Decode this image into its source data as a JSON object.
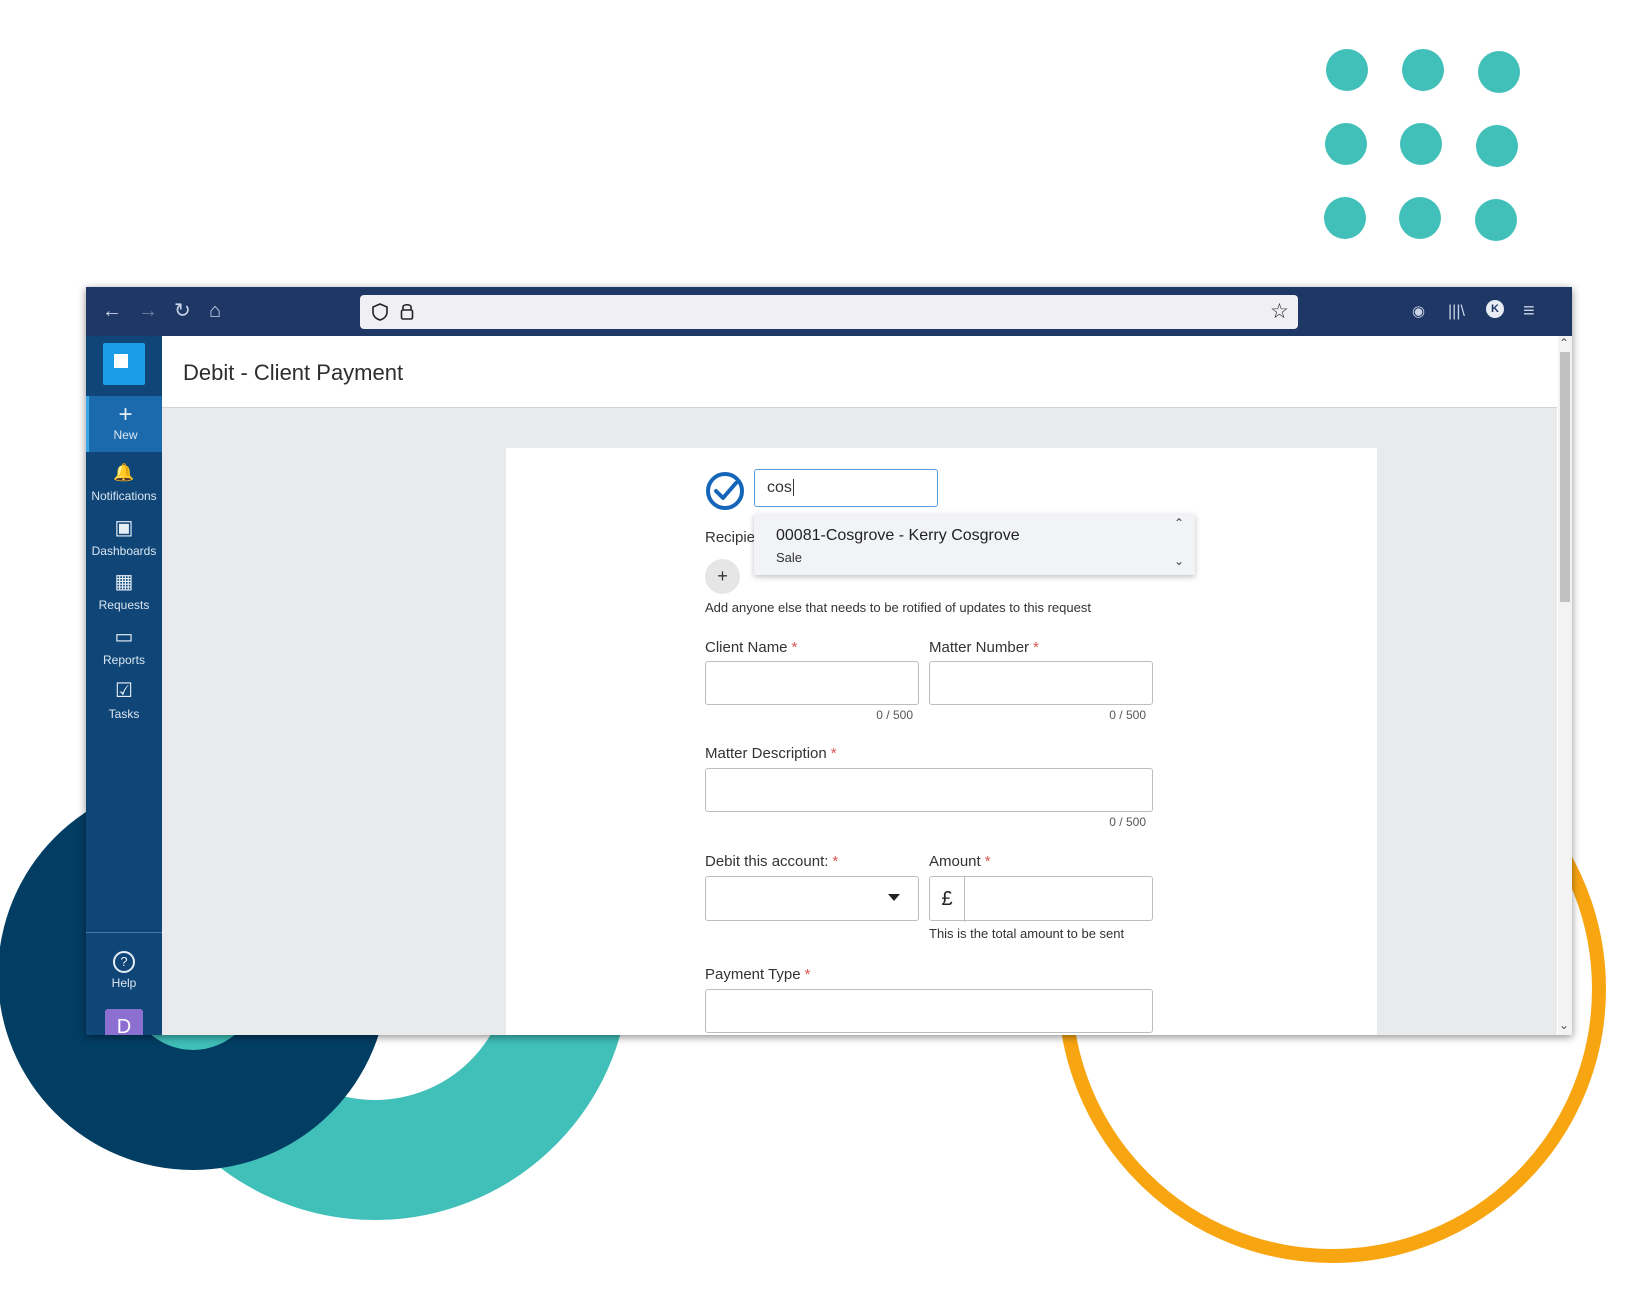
{
  "browser": {
    "toolbar_icons": [
      "back-icon",
      "forward-icon",
      "reload-icon",
      "home-icon"
    ],
    "url_icons": [
      "shield-icon",
      "lock-icon"
    ],
    "right_icons": [
      "extension-icon",
      "library-icon",
      "profile-icon",
      "menu-icon"
    ],
    "profile_initial": "K"
  },
  "sidebar": {
    "items": [
      {
        "label": "New",
        "icon": "+"
      },
      {
        "label": "Notifications",
        "icon": "🔔"
      },
      {
        "label": "Dashboards",
        "icon": "▣"
      },
      {
        "label": "Requests",
        "icon": "▦"
      },
      {
        "label": "Reports",
        "icon": "▭"
      },
      {
        "label": "Tasks",
        "icon": "☑"
      }
    ],
    "help_label": "Help",
    "help_icon": "?",
    "avatar_initial": "D"
  },
  "header": {
    "title": "Debit - Client Payment"
  },
  "form": {
    "search_value": "cos",
    "recipients_label": "Recipie",
    "add_recipient": "+",
    "recipients_hint": "Add anyone else that needs to be rotified of updates to this request",
    "client_name_label": "Client Name",
    "client_name_counter": "0 / 500",
    "matter_number_label": "Matter Number",
    "matter_number_counter": "0 / 500",
    "matter_description_label": "Matter Description",
    "matter_description_counter": "0 / 500",
    "debit_account_label": "Debit this account:",
    "amount_label": "Amount",
    "currency_symbol": "£",
    "amount_hint": "This is the total amount to be sent",
    "payment_type_label": "Payment Type",
    "required_mark": "*"
  },
  "autocomplete": {
    "item_title": "00081-Cosgrove - Kerry Cosgrove",
    "item_subtitle": "Sale"
  },
  "colors": {
    "toolbar": "#1e3765",
    "sidebar": "#0f4677",
    "accent_teal": "#41bfb9",
    "accent_navy": "#023e63",
    "accent_orange": "#f8a512",
    "avatar": "#8c6fd1"
  }
}
